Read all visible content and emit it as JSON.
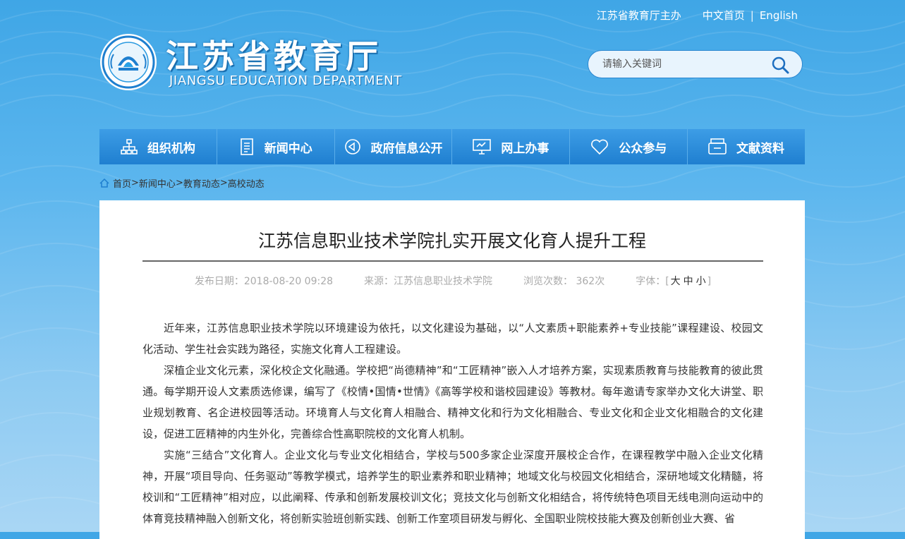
{
  "header": {
    "sponsor": "江苏省教育厅主办",
    "home_link": "中文首页",
    "separator": "|",
    "english_link": "English",
    "logo_cn": "江苏省教育厅",
    "logo_en": "JIANGSU EDUCATION DEPARTMENT"
  },
  "search": {
    "placeholder": "请输入关键词"
  },
  "nav": {
    "items": [
      {
        "label": "组织机构",
        "icon": "org-chart-icon"
      },
      {
        "label": "新闻中心",
        "icon": "document-icon"
      },
      {
        "label": "政府信息公开",
        "icon": "megaphone-icon"
      },
      {
        "label": "网上办事",
        "icon": "monitor-icon"
      },
      {
        "label": "公众参与",
        "icon": "heart-icon"
      },
      {
        "label": "文献资料",
        "icon": "archive-icon"
      }
    ]
  },
  "breadcrumb": {
    "items": [
      "首页",
      "新闻中心",
      "教育动态",
      "高校动态"
    ],
    "sep": ">"
  },
  "article": {
    "title": "江苏信息职业技术学院扎实开展文化育人提升工程",
    "date": "发布日期：2018-08-20 09:28",
    "source": "来源：江苏信息职业技术学院",
    "views": "浏览次数： 362次",
    "font_label": "字体：",
    "font_open": "[",
    "font_large": "大",
    "font_medium": "中",
    "font_small": "小",
    "font_close": "]",
    "paragraphs": [
      "近年来，江苏信息职业技术学院以环境建设为依托，以文化建设为基础，以“人文素质+职能素养+专业技能”课程建设、校园文化活动、学生社会实践为路径，实施文化育人工程建设。",
      "深植企业文化元素，深化校企文化融通。学校把“尚德精神”和“工匠精神”嵌入人才培养方案，实现素质教育与技能教育的彼此贯通。每学期开设人文素质选修课，编写了《校情•国情•世情》《高等学校和谐校园建设》等教材。每年邀请专家举办文化大讲堂、职业规划教育、名企进校园等活动。环境育人与文化育人相融合、精神文化和行为文化相融合、专业文化和企业文化相融合的文化建设，促进工匠精神的内生外化，完善综合性高职院校的文化育人机制。",
      "实施“三结合”文化育人。企业文化与专业文化相结合，学校与500多家企业深度开展校企合作，在课程教学中融入企业文化精神，开展“项目导向、任务驱动”等教学模式，培养学生的职业素养和职业精神；地域文化与校园文化相结合，深研地域文化精髓，将校训和“工匠精神”相对应，以此阐释、传承和创新发展校训文化；竞技文化与创新文化相结合，将传统特色项目无线电测向运动中的体育竞技精神融入创新文化，将创新实验班创新实践、创新工作室项目研发与孵化、全国职业院校技能大赛及创新创业大赛、省"
    ]
  }
}
